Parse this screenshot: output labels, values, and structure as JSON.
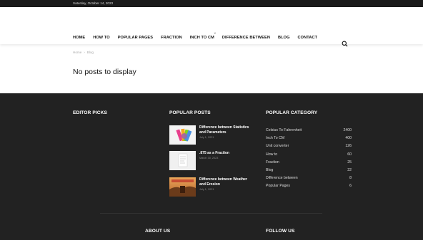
{
  "topbar": {
    "date": "Saturday, October 14, 2023"
  },
  "nav": {
    "items": [
      "HOME",
      "HOW TO",
      "POPULAR PAGES",
      "FRACTION",
      "INCH TO CM",
      "DIFFERENCE BETWEEN",
      "BLOG",
      "CONTACT"
    ]
  },
  "breadcrumb": {
    "home": "Home",
    "sep": "›",
    "current": "Blog"
  },
  "page": {
    "title": "No posts to display"
  },
  "footer": {
    "editor_picks": "EDITOR PICKS",
    "popular_posts": "POPULAR POSTS",
    "popular_category": "POPULAR CATEGORY",
    "posts": [
      {
        "title": "Difference between Statistics and Parameters",
        "date": "July 1, 2021"
      },
      {
        "title": ".875 as a Fraction",
        "date": "March 30, 2023"
      },
      {
        "title": "Difference between Weather and Erosion",
        "date": "July 1, 2021"
      }
    ],
    "categories": [
      {
        "name": "Celsius To Fahrenheit",
        "count": "2400"
      },
      {
        "name": "Inch To CM",
        "count": "400"
      },
      {
        "name": "Unit converter",
        "count": "126"
      },
      {
        "name": "How to",
        "count": "60"
      },
      {
        "name": "Fraction",
        "count": "25"
      },
      {
        "name": "Blog",
        "count": "22"
      },
      {
        "name": "Difference between",
        "count": "8"
      },
      {
        "name": "Popular Pages",
        "count": "6"
      }
    ],
    "about_us": "ABOUT US",
    "follow_us": "FOLLOW US"
  }
}
